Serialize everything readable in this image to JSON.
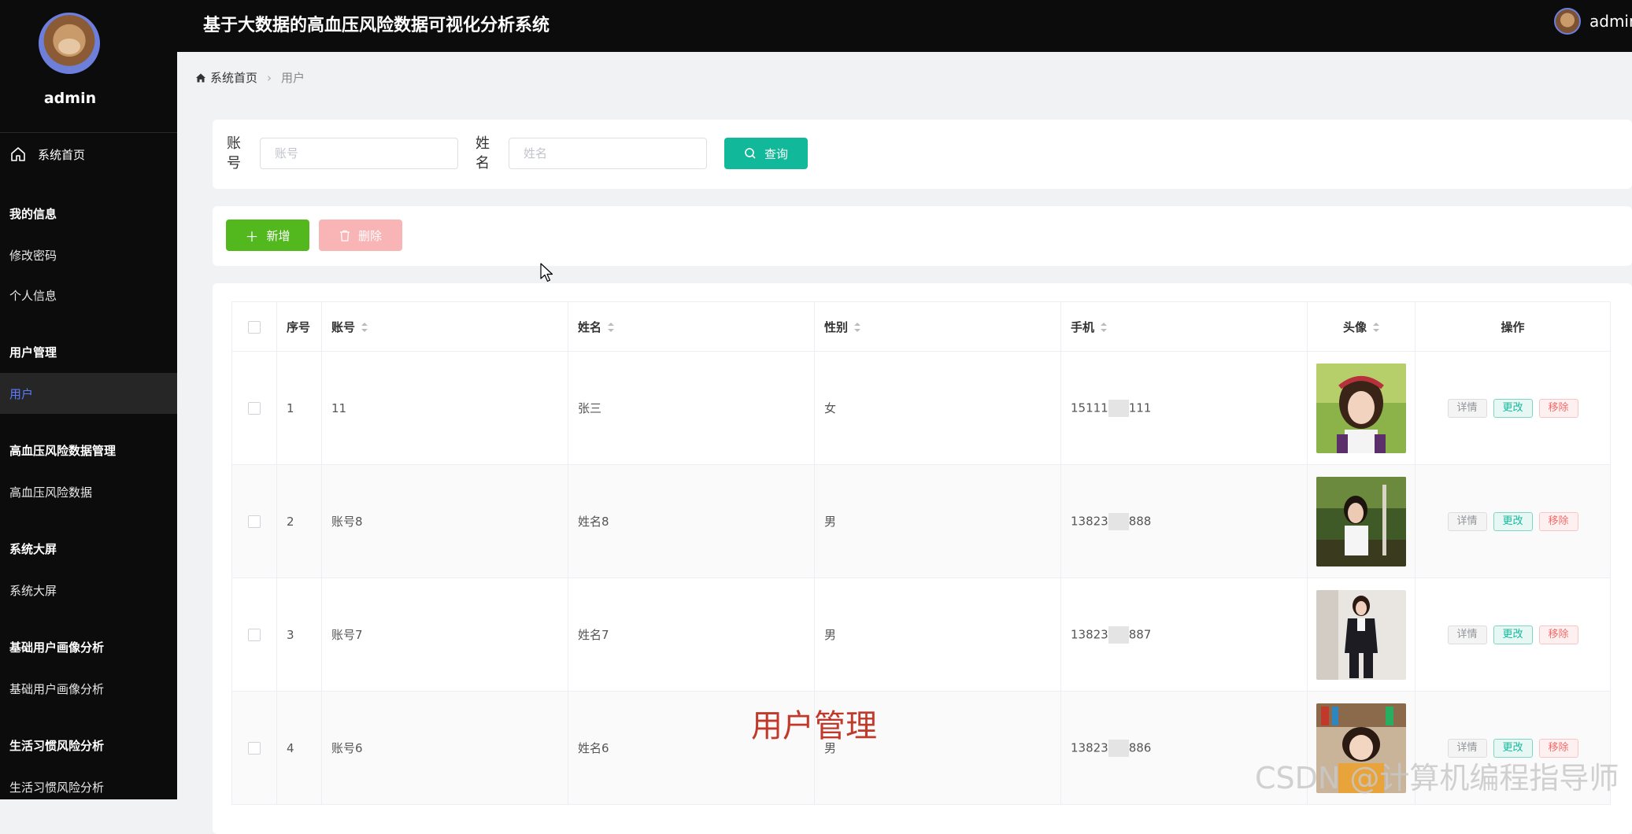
{
  "header": {
    "title": "基于大数据的高血压风险数据可视化分析系统",
    "user": "admin"
  },
  "sidebar": {
    "username": "admin",
    "items": [
      {
        "label": "系统首页",
        "type": "home"
      },
      {
        "label": "我的信息",
        "type": "group"
      },
      {
        "label": "修改密码",
        "type": "sub"
      },
      {
        "label": "个人信息",
        "type": "sub"
      },
      {
        "label": "用户管理",
        "type": "group"
      },
      {
        "label": "用户",
        "type": "sub",
        "active": true
      },
      {
        "label": "高血压风险数据管理",
        "type": "group"
      },
      {
        "label": "高血压风险数据",
        "type": "sub"
      },
      {
        "label": "系统大屏",
        "type": "group"
      },
      {
        "label": "系统大屏",
        "type": "sub"
      },
      {
        "label": "基础用户画像分析",
        "type": "group"
      },
      {
        "label": "基础用户画像分析",
        "type": "sub"
      },
      {
        "label": "生活习惯风险分析",
        "type": "group"
      },
      {
        "label": "生活习惯风险分析",
        "type": "sub"
      }
    ]
  },
  "breadcrumb": {
    "home": "系统首页",
    "current": "用户"
  },
  "search": {
    "account_label": "账号",
    "account_placeholder": "账号",
    "name_label": "姓名",
    "name_placeholder": "姓名",
    "query_button": "查询"
  },
  "actions": {
    "add": "新增",
    "delete": "删除"
  },
  "table": {
    "columns": [
      "序号",
      "账号",
      "姓名",
      "性别",
      "手机",
      "头像",
      "操作"
    ],
    "rows": [
      {
        "index": "1",
        "account": "11",
        "name": "张三",
        "gender": "女",
        "phone_prefix": "15111",
        "phone_suffix": "111"
      },
      {
        "index": "2",
        "account": "账号8",
        "name": "姓名8",
        "gender": "男",
        "phone_prefix": "13823",
        "phone_suffix": "888"
      },
      {
        "index": "3",
        "account": "账号7",
        "name": "姓名7",
        "gender": "男",
        "phone_prefix": "13823",
        "phone_suffix": "887"
      },
      {
        "index": "4",
        "account": "账号6",
        "name": "姓名6",
        "gender": "男",
        "phone_prefix": "13823",
        "phone_suffix": "886"
      }
    ],
    "ops": {
      "detail": "详情",
      "edit": "更改",
      "remove": "移除"
    }
  },
  "overlay_title": "用户管理",
  "watermark": "CSDN @计算机编程指导师"
}
